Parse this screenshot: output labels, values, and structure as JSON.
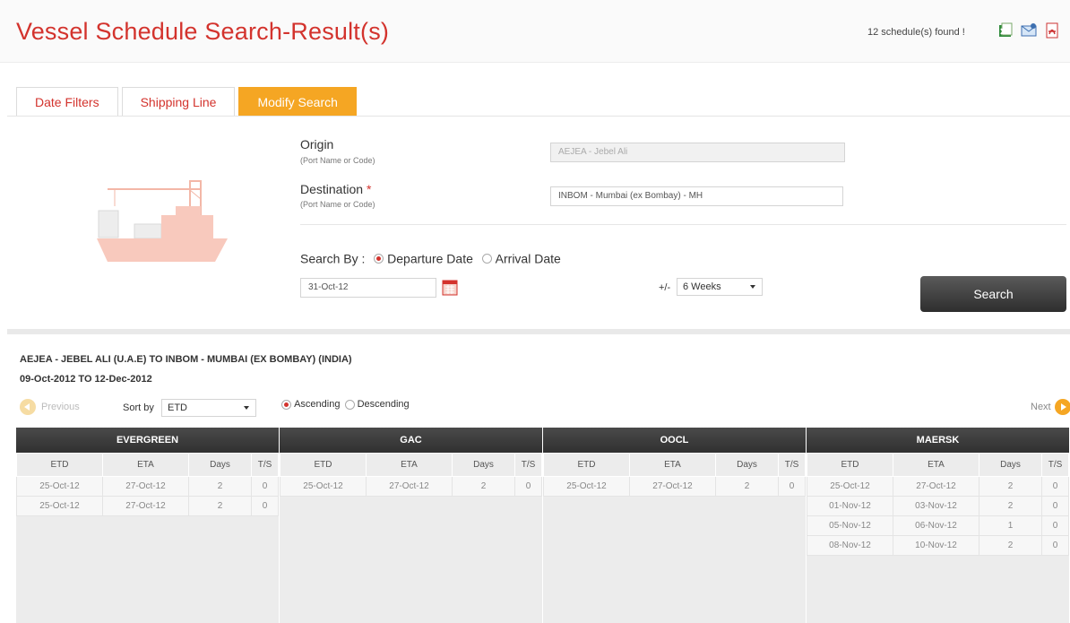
{
  "header": {
    "title": "Vessel Schedule Search-Result(s)",
    "found_text": "12 schedule(s) found !",
    "export_icons": [
      "excel-icon",
      "email-icon",
      "pdf-icon"
    ]
  },
  "tabs": [
    {
      "label": "Date Filters",
      "active": false
    },
    {
      "label": "Shipping Line",
      "active": false
    },
    {
      "label": "Modify Search",
      "active": true
    }
  ],
  "form": {
    "origin_label": "Origin",
    "origin_hint": "(Port Name or Code)",
    "origin_value": "AEJEA - Jebel Ali",
    "destination_label": "Destination",
    "destination_required": "*",
    "destination_hint": "(Port Name or Code)",
    "destination_value": "INBOM - Mumbai (ex Bombay) - MH",
    "search_by_label": "Search By :",
    "search_by_options": [
      {
        "label": "Departure Date",
        "selected": true
      },
      {
        "label": "Arrival Date",
        "selected": false
      }
    ],
    "date_value": "31-Oct-12",
    "weeks_label": "+/-",
    "weeks_value": "6 Weeks",
    "search_button": "Search"
  },
  "results": {
    "route_title": "AEJEA - JEBEL ALI (U.A.E) TO INBOM - MUMBAI (EX BOMBAY) (INDIA)",
    "date_range": "09-Oct-2012 TO 12-Dec-2012",
    "previous_label": "Previous",
    "next_label": "Next",
    "sort_by_label": "Sort by",
    "sort_by_value": "ETD",
    "order_options": [
      {
        "label": "Ascending",
        "selected": true
      },
      {
        "label": "Descending",
        "selected": false
      }
    ],
    "columns": {
      "etd": "ETD",
      "eta": "ETA",
      "days": "Days",
      "ts": "T/S"
    },
    "carriers": [
      {
        "name": "EVERGREEN",
        "rows": [
          {
            "etd": "25-Oct-12",
            "eta": "27-Oct-12",
            "days": "2",
            "ts": "0"
          },
          {
            "etd": "25-Oct-12",
            "eta": "27-Oct-12",
            "days": "2",
            "ts": "0"
          }
        ]
      },
      {
        "name": "GAC",
        "rows": [
          {
            "etd": "25-Oct-12",
            "eta": "27-Oct-12",
            "days": "2",
            "ts": "0"
          }
        ]
      },
      {
        "name": "OOCL",
        "rows": [
          {
            "etd": "25-Oct-12",
            "eta": "27-Oct-12",
            "days": "2",
            "ts": "0"
          }
        ]
      },
      {
        "name": "MAERSK",
        "rows": [
          {
            "etd": "25-Oct-12",
            "eta": "27-Oct-12",
            "days": "2",
            "ts": "0"
          },
          {
            "etd": "01-Nov-12",
            "eta": "03-Nov-12",
            "days": "2",
            "ts": "0"
          },
          {
            "etd": "05-Nov-12",
            "eta": "06-Nov-12",
            "days": "1",
            "ts": "0"
          },
          {
            "etd": "08-Nov-12",
            "eta": "10-Nov-12",
            "days": "2",
            "ts": "0"
          }
        ]
      }
    ]
  },
  "colors": {
    "brand_red": "#d3332d",
    "accent_orange": "#f5a623",
    "header_dark": "#3a3a3a"
  }
}
